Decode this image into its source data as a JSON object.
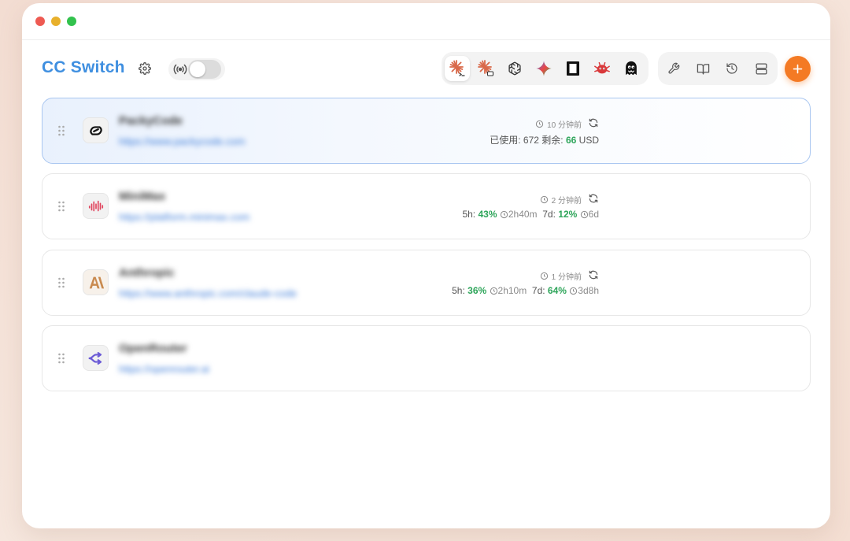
{
  "app": {
    "title": "CC Switch"
  },
  "colors": {
    "accent": "#3f8fe0",
    "add": "#f47a24",
    "usage_green": "#2ea55a"
  },
  "toolbar": {
    "apps": [
      {
        "name": "claude-code",
        "icon": "claude-code-icon",
        "active": true
      },
      {
        "name": "claude-desktop",
        "icon": "claude-desktop-icon",
        "active": false
      },
      {
        "name": "openai",
        "icon": "openai-icon",
        "active": false
      },
      {
        "name": "gemini",
        "icon": "gemini-icon",
        "active": false
      },
      {
        "name": "terminal",
        "icon": "terminal-icon",
        "active": false
      },
      {
        "name": "bug",
        "icon": "bug-icon",
        "active": false
      },
      {
        "name": "ghost",
        "icon": "ghost-icon",
        "active": false
      }
    ],
    "actions": [
      "wrench-icon",
      "book-icon",
      "history-icon",
      "server-icon"
    ],
    "add_label": "+"
  },
  "providers": [
    {
      "name": "PackyCode",
      "url": "https://www.packycode.com",
      "time": "10 分钟前",
      "usage": {
        "used_label": "已使用:",
        "used": "672",
        "remaining_label": "剩余:",
        "remaining": "66",
        "unit": "USD"
      }
    },
    {
      "name": "MiniMax",
      "url": "https://platform.minimax.com",
      "time": "2 分钟前",
      "limits": {
        "h5_label": "5h:",
        "h5": "43%",
        "h5_reset": "2h40m",
        "d7_label": "7d:",
        "d7": "12%",
        "d7_reset": "6d"
      }
    },
    {
      "name": "Anthropic",
      "url": "https://www.anthropic.com/claude-code",
      "time": "1 分钟前",
      "limits": {
        "h5_label": "5h:",
        "h5": "36%",
        "h5_reset": "2h10m",
        "d7_label": "7d:",
        "d7": "64%",
        "d7_reset": "3d8h"
      }
    },
    {
      "name": "OpenRouter",
      "url": "https://openrouter.ai"
    }
  ]
}
